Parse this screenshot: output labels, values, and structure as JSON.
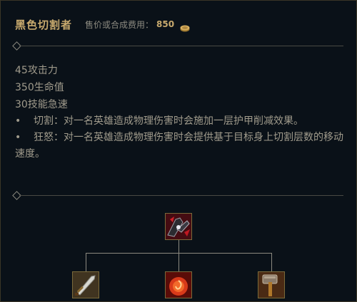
{
  "item": {
    "name": "黑色切割者",
    "price_label": "售价或合成费用：",
    "price": "850",
    "coin_icon": "gold-coin-icon"
  },
  "stats": [
    "45攻击力",
    "350生命值",
    "30技能急速"
  ],
  "passives": [
    {
      "bullet": "•",
      "text": "切割：对一名英雄造成物理伤害时会施加一层护甲削减效果。"
    },
    {
      "bullet": "•",
      "text": "狂怒：对一名英雄造成物理伤害时会提供基于目标身上切割层数的移动速度。"
    }
  ],
  "recipe": {
    "result_icon": "black-cleaver-icon",
    "components": [
      "long-sword-icon",
      "ruby-crystal-icon",
      "warhammer-icon"
    ]
  },
  "colors": {
    "gold": "#c8aa6e",
    "text": "#a09b8c",
    "label": "#8c8a80",
    "background": "#0a1118"
  }
}
